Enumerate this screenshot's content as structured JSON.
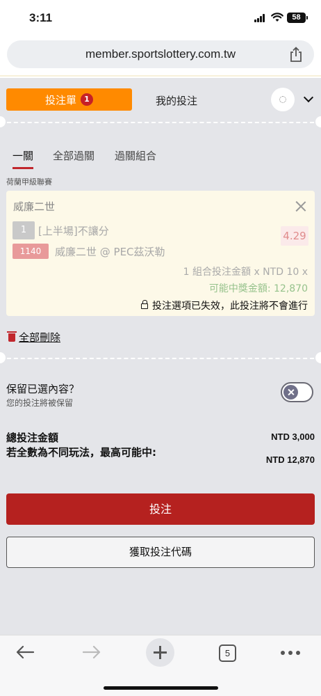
{
  "status_bar": {
    "time": "3:11",
    "battery": "58"
  },
  "browser": {
    "url": "member.sportslottery.com.tw",
    "tab_count": "5"
  },
  "header_tabs": {
    "betslip_label": "投注單",
    "betslip_count": "1",
    "my_bets_label": "我的投注"
  },
  "sub_tabs": [
    {
      "label": "一關",
      "active": true
    },
    {
      "label": "全部過關",
      "active": false
    },
    {
      "label": "過關組合",
      "active": false
    }
  ],
  "league": "荷蘭甲級聯賽",
  "bet": {
    "team": "威廉二世",
    "line_number": "1",
    "market": "[上半場]不讓分",
    "odds": "4.29",
    "code": "1140",
    "selection": "威廉二世 @ PEC茲沃勒",
    "stake_line": "1 組合投注金額 x NTD 10 x",
    "potential_win": "可能中獎金額: 12,870",
    "expired_notice": "投注選項已失效，此投注將不會進行"
  },
  "delete_all_label": "全部刪除",
  "keep_selection": {
    "title": "保留已選內容？",
    "subtitle": "您的投注將被保留",
    "enabled": false
  },
  "summary": {
    "total_label": "總投注金額",
    "total_value": "NTD 3,000",
    "max_label": "若全數為不同玩法，最高可能中:",
    "max_value": "NTD 12,870"
  },
  "buttons": {
    "place_bet": "投注",
    "get_code": "獲取投注代碼"
  },
  "colors": {
    "accent_orange": "#ff8a00",
    "primary_red": "#b5211f",
    "win_green": "#96c28c"
  }
}
